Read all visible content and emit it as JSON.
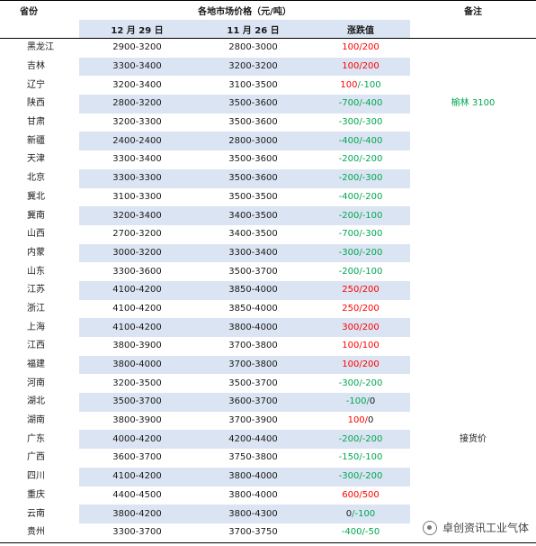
{
  "headers": {
    "province": "省份",
    "market_price": "各地市场价格（元/吨）",
    "remark": "备注",
    "date_current": "12 月 29 日",
    "date_previous": "11 月 26 日",
    "change": "涨跌值"
  },
  "rows": [
    {
      "province": "黑龙江",
      "current": "2900-3200",
      "previous": "2800-3000",
      "change_a": "100",
      "change_a_dir": "up",
      "change_b": "200",
      "change_b_dir": "up",
      "remark": ""
    },
    {
      "province": "吉林",
      "current": "3300-3400",
      "previous": "3200-3200",
      "change_a": "100",
      "change_a_dir": "up",
      "change_b": "200",
      "change_b_dir": "up",
      "remark": ""
    },
    {
      "province": "辽宁",
      "current": "3200-3400",
      "previous": "3100-3500",
      "change_a": "100",
      "change_a_dir": "up",
      "change_b": "-100",
      "change_b_dir": "down",
      "remark": ""
    },
    {
      "province": "陕西",
      "current": "2800-3200",
      "previous": "3500-3600",
      "change_a": "-700",
      "change_a_dir": "down",
      "change_b": "-400",
      "change_b_dir": "down",
      "remark": "榆林 3100"
    },
    {
      "province": "甘肃",
      "current": "3200-3300",
      "previous": "3500-3600",
      "change_a": "-300",
      "change_a_dir": "down",
      "change_b": "-300",
      "change_b_dir": "down",
      "remark": ""
    },
    {
      "province": "新疆",
      "current": "2400-2400",
      "previous": "2800-3000",
      "change_a": "-400",
      "change_a_dir": "down",
      "change_b": "-400",
      "change_b_dir": "down",
      "remark": ""
    },
    {
      "province": "天津",
      "current": "3300-3400",
      "previous": "3500-3600",
      "change_a": "-200",
      "change_a_dir": "down",
      "change_b": "-200",
      "change_b_dir": "down",
      "remark": ""
    },
    {
      "province": "北京",
      "current": "3300-3300",
      "previous": "3500-3600",
      "change_a": "-200",
      "change_b": "-300",
      "change_a_dir": "down",
      "change_b_dir": "down",
      "remark": ""
    },
    {
      "province": "冀北",
      "current": "3100-3300",
      "previous": "3500-3500",
      "change_a": "-400",
      "change_a_dir": "down",
      "change_b": "-200",
      "change_b_dir": "down",
      "remark": ""
    },
    {
      "province": "冀南",
      "current": "3200-3400",
      "previous": "3400-3500",
      "change_a": "-200",
      "change_a_dir": "down",
      "change_b": "-100",
      "change_b_dir": "down",
      "remark": ""
    },
    {
      "province": "山西",
      "current": "2700-3200",
      "previous": "3400-3500",
      "change_a": "-700",
      "change_a_dir": "down",
      "change_b": "-300",
      "change_b_dir": "down",
      "remark": ""
    },
    {
      "province": "内蒙",
      "current": "3000-3200",
      "previous": "3300-3400",
      "change_a": "-300",
      "change_a_dir": "down",
      "change_b": "-200",
      "change_b_dir": "down",
      "remark": ""
    },
    {
      "province": "山东",
      "current": "3300-3600",
      "previous": "3500-3700",
      "change_a": "-200",
      "change_a_dir": "down",
      "change_b": "-100",
      "change_b_dir": "down",
      "remark": ""
    },
    {
      "province": "江苏",
      "current": "4100-4200",
      "previous": "3850-4000",
      "change_a": "250",
      "change_a_dir": "up",
      "change_b": "200",
      "change_b_dir": "up",
      "remark": ""
    },
    {
      "province": "浙江",
      "current": "4100-4200",
      "previous": "3850-4000",
      "change_a": "250",
      "change_a_dir": "up",
      "change_b": "200",
      "change_b_dir": "up",
      "remark": ""
    },
    {
      "province": "上海",
      "current": "4100-4200",
      "previous": "3800-4000",
      "change_a": "300",
      "change_a_dir": "up",
      "change_b": "200",
      "change_b_dir": "up",
      "remark": ""
    },
    {
      "province": "江西",
      "current": "3800-3900",
      "previous": "3700-3800",
      "change_a": "100",
      "change_a_dir": "up",
      "change_b": "100",
      "change_b_dir": "up",
      "remark": ""
    },
    {
      "province": "福建",
      "current": "3800-4000",
      "previous": "3700-3800",
      "change_a": "100",
      "change_a_dir": "up",
      "change_b": "200",
      "change_b_dir": "up",
      "remark": ""
    },
    {
      "province": "河南",
      "current": "3200-3500",
      "previous": "3500-3700",
      "change_a": "-300",
      "change_a_dir": "down",
      "change_b": "-200",
      "change_b_dir": "down",
      "remark": ""
    },
    {
      "province": "湖北",
      "current": "3500-3700",
      "previous": "3600-3700",
      "change_a": "-100",
      "change_a_dir": "down",
      "change_b": "0",
      "change_b_dir": "neutral",
      "remark": ""
    },
    {
      "province": "湖南",
      "current": "3800-3900",
      "previous": "3700-3900",
      "change_a": "100",
      "change_a_dir": "up",
      "change_b": "0",
      "change_b_dir": "neutral",
      "remark": ""
    },
    {
      "province": "广东",
      "current": "4000-4200",
      "previous": "4200-4400",
      "change_a": "-200",
      "change_a_dir": "down",
      "change_b": "-200",
      "change_b_dir": "down",
      "remark": "接货价"
    },
    {
      "province": "广西",
      "current": "3600-3700",
      "previous": "3750-3800",
      "change_a": "-150",
      "change_a_dir": "down",
      "change_b": "-100",
      "change_b_dir": "down",
      "remark": ""
    },
    {
      "province": "四川",
      "current": "4100-4200",
      "previous": "3800-4000",
      "change_a": "-300",
      "change_a_dir": "down",
      "change_b": "-200",
      "change_b_dir": "down",
      "remark": ""
    },
    {
      "province": "重庆",
      "current": "4400-4500",
      "previous": "3800-4000",
      "change_a": "600",
      "change_a_dir": "up",
      "change_b": "500",
      "change_b_dir": "up",
      "remark": ""
    },
    {
      "province": "云南",
      "current": "3800-4200",
      "previous": "3800-4300",
      "change_a": "0",
      "change_a_dir": "neutral",
      "change_b": "-100",
      "change_b_dir": "down",
      "remark": ""
    },
    {
      "province": "贵州",
      "current": "3300-3700",
      "previous": "3700-3750",
      "change_a": "-400",
      "change_a_dir": "down",
      "change_b": "-50",
      "change_b_dir": "down",
      "remark": ""
    }
  ],
  "watermark": {
    "icon": "wechat-channel-icon",
    "text": "卓创资讯工业气体"
  },
  "colors": {
    "header_band": "#dbe4f2",
    "up": "#ff0000",
    "down": "#00a651"
  }
}
